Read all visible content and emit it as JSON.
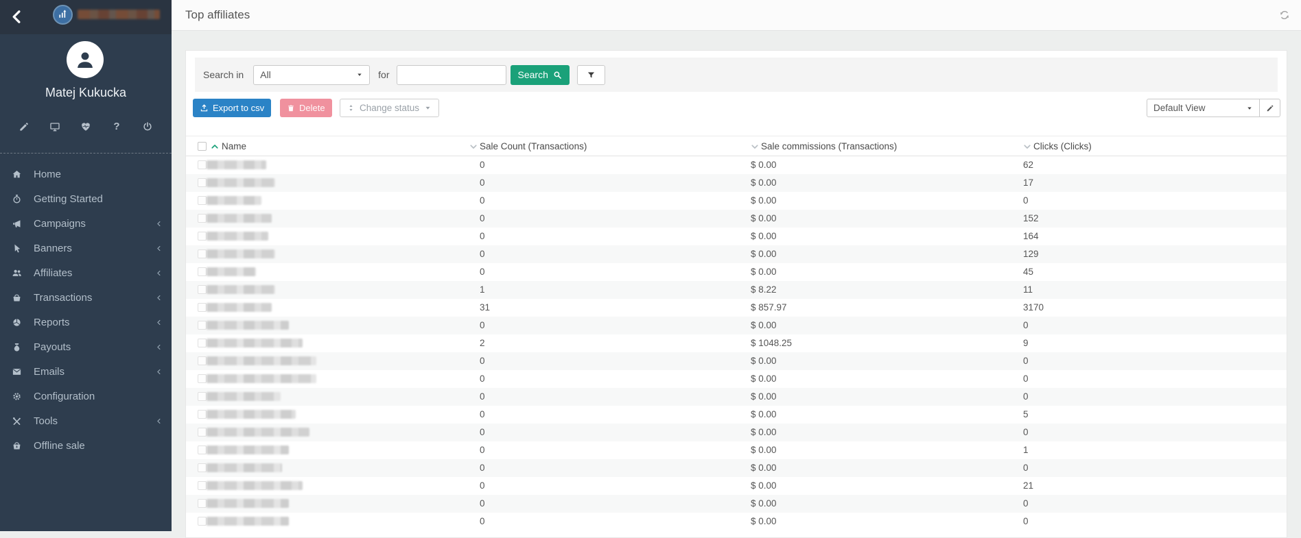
{
  "colors": {
    "sidebar-bg": "#2e3d4e",
    "sidebar-header-bg": "#2a3441",
    "nav-text": "#b3bfca",
    "topbar-bg": "#fbfbfb",
    "page-bg": "#edefee",
    "strip-bg": "#f4f4f4",
    "green": "#1aa179",
    "blue": "#2b83c6",
    "pink": "#f0919e",
    "text": "#555555",
    "row-alt": "#f7f8f8",
    "caret-gray": "#b9c0c5"
  },
  "sidebar": {
    "user_name": "Matej Kukucka",
    "logo_icon": "growth-chart-icon",
    "company_name_redacted": true,
    "quick_icons": [
      "pencil",
      "monitor",
      "heartbeat",
      "question",
      "power"
    ],
    "question_glyph": "?",
    "nav": [
      {
        "label": "Home",
        "icon": "home",
        "has_submenu": false
      },
      {
        "label": "Getting Started",
        "icon": "stopwatch",
        "has_submenu": false
      },
      {
        "label": "Campaigns",
        "icon": "megaphone",
        "has_submenu": true
      },
      {
        "label": "Banners",
        "icon": "pointer",
        "has_submenu": true
      },
      {
        "label": "Affiliates",
        "icon": "users",
        "has_submenu": true
      },
      {
        "label": "Transactions",
        "icon": "basket",
        "has_submenu": true
      },
      {
        "label": "Reports",
        "icon": "pie",
        "has_submenu": true
      },
      {
        "label": "Payouts",
        "icon": "moneybag",
        "has_submenu": true
      },
      {
        "label": "Emails",
        "icon": "envelope",
        "has_submenu": true
      },
      {
        "label": "Configuration",
        "icon": "gear",
        "has_submenu": false
      },
      {
        "label": "Tools",
        "icon": "tools",
        "has_submenu": true
      },
      {
        "label": "Offline sale",
        "icon": "basket2",
        "has_submenu": false
      }
    ]
  },
  "topbar": {
    "title": "Top affiliates"
  },
  "search": {
    "label": "Search in",
    "select_value": "All",
    "for_label": "for",
    "input_value": "",
    "button_label": "Search"
  },
  "actions": {
    "export_label": "Export to csv",
    "delete_label": "Delete",
    "change_status_label": "Change status",
    "view_value": "Default View"
  },
  "table": {
    "columns": [
      {
        "label": "Name",
        "sort": "asc"
      },
      {
        "label": "Sale Count (Transactions)",
        "sort": "none"
      },
      {
        "label": "Sale commissions (Transactions)",
        "sort": "none"
      },
      {
        "label": "Clicks (Clicks)",
        "sort": "none"
      }
    ],
    "rows": [
      {
        "name_redacted": true,
        "blur_width": 87,
        "sale": "0",
        "commission": "$ 0.00",
        "clicks": "62"
      },
      {
        "name_redacted": true,
        "blur_width": 100,
        "sale": "0",
        "commission": "$ 0.00",
        "clicks": "17"
      },
      {
        "name_redacted": true,
        "blur_width": 80,
        "sale": "0",
        "commission": "$ 0.00",
        "clicks": "0"
      },
      {
        "name_redacted": true,
        "blur_width": 95,
        "sale": "0",
        "commission": "$ 0.00",
        "clicks": "152"
      },
      {
        "name_redacted": true,
        "blur_width": 90,
        "sale": "0",
        "commission": "$ 0.00",
        "clicks": "164"
      },
      {
        "name_redacted": true,
        "blur_width": 100,
        "sale": "0",
        "commission": "$ 0.00",
        "clicks": "129"
      },
      {
        "name_redacted": true,
        "blur_width": 72,
        "sale": "0",
        "commission": "$ 0.00",
        "clicks": "45"
      },
      {
        "name_redacted": true,
        "blur_width": 100,
        "sale": "1",
        "commission": "$ 8.22",
        "clicks": "11"
      },
      {
        "name_redacted": true,
        "blur_width": 95,
        "sale": "31",
        "commission": "$ 857.97",
        "clicks": "3170"
      },
      {
        "name_redacted": true,
        "blur_width": 120,
        "sale": "0",
        "commission": "$ 0.00",
        "clicks": "0"
      },
      {
        "name_redacted": true,
        "blur_width": 140,
        "sale": "2",
        "commission": "$ 1048.25",
        "clicks": "9"
      },
      {
        "name_redacted": true,
        "blur_width": 160,
        "sale": "0",
        "commission": "$ 0.00",
        "clicks": "0"
      },
      {
        "name_redacted": true,
        "blur_width": 160,
        "sale": "0",
        "commission": "$ 0.00",
        "clicks": "0"
      },
      {
        "name_redacted": true,
        "blur_width": 108,
        "sale": "0",
        "commission": "$ 0.00",
        "clicks": "0"
      },
      {
        "name_redacted": true,
        "blur_width": 130,
        "sale": "0",
        "commission": "$ 0.00",
        "clicks": "5"
      },
      {
        "name_redacted": true,
        "blur_width": 150,
        "sale": "0",
        "commission": "$ 0.00",
        "clicks": "0"
      },
      {
        "name_redacted": true,
        "blur_width": 120,
        "sale": "0",
        "commission": "$ 0.00",
        "clicks": "1"
      },
      {
        "name_redacted": true,
        "blur_width": 110,
        "sale": "0",
        "commission": "$ 0.00",
        "clicks": "0"
      },
      {
        "name_redacted": true,
        "blur_width": 140,
        "sale": "0",
        "commission": "$ 0.00",
        "clicks": "21"
      },
      {
        "name_redacted": true,
        "blur_width": 120,
        "sale": "0",
        "commission": "$ 0.00",
        "clicks": "0"
      },
      {
        "name_redacted": true,
        "blur_width": 120,
        "sale": "0",
        "commission": "$ 0.00",
        "clicks": "0"
      }
    ]
  }
}
